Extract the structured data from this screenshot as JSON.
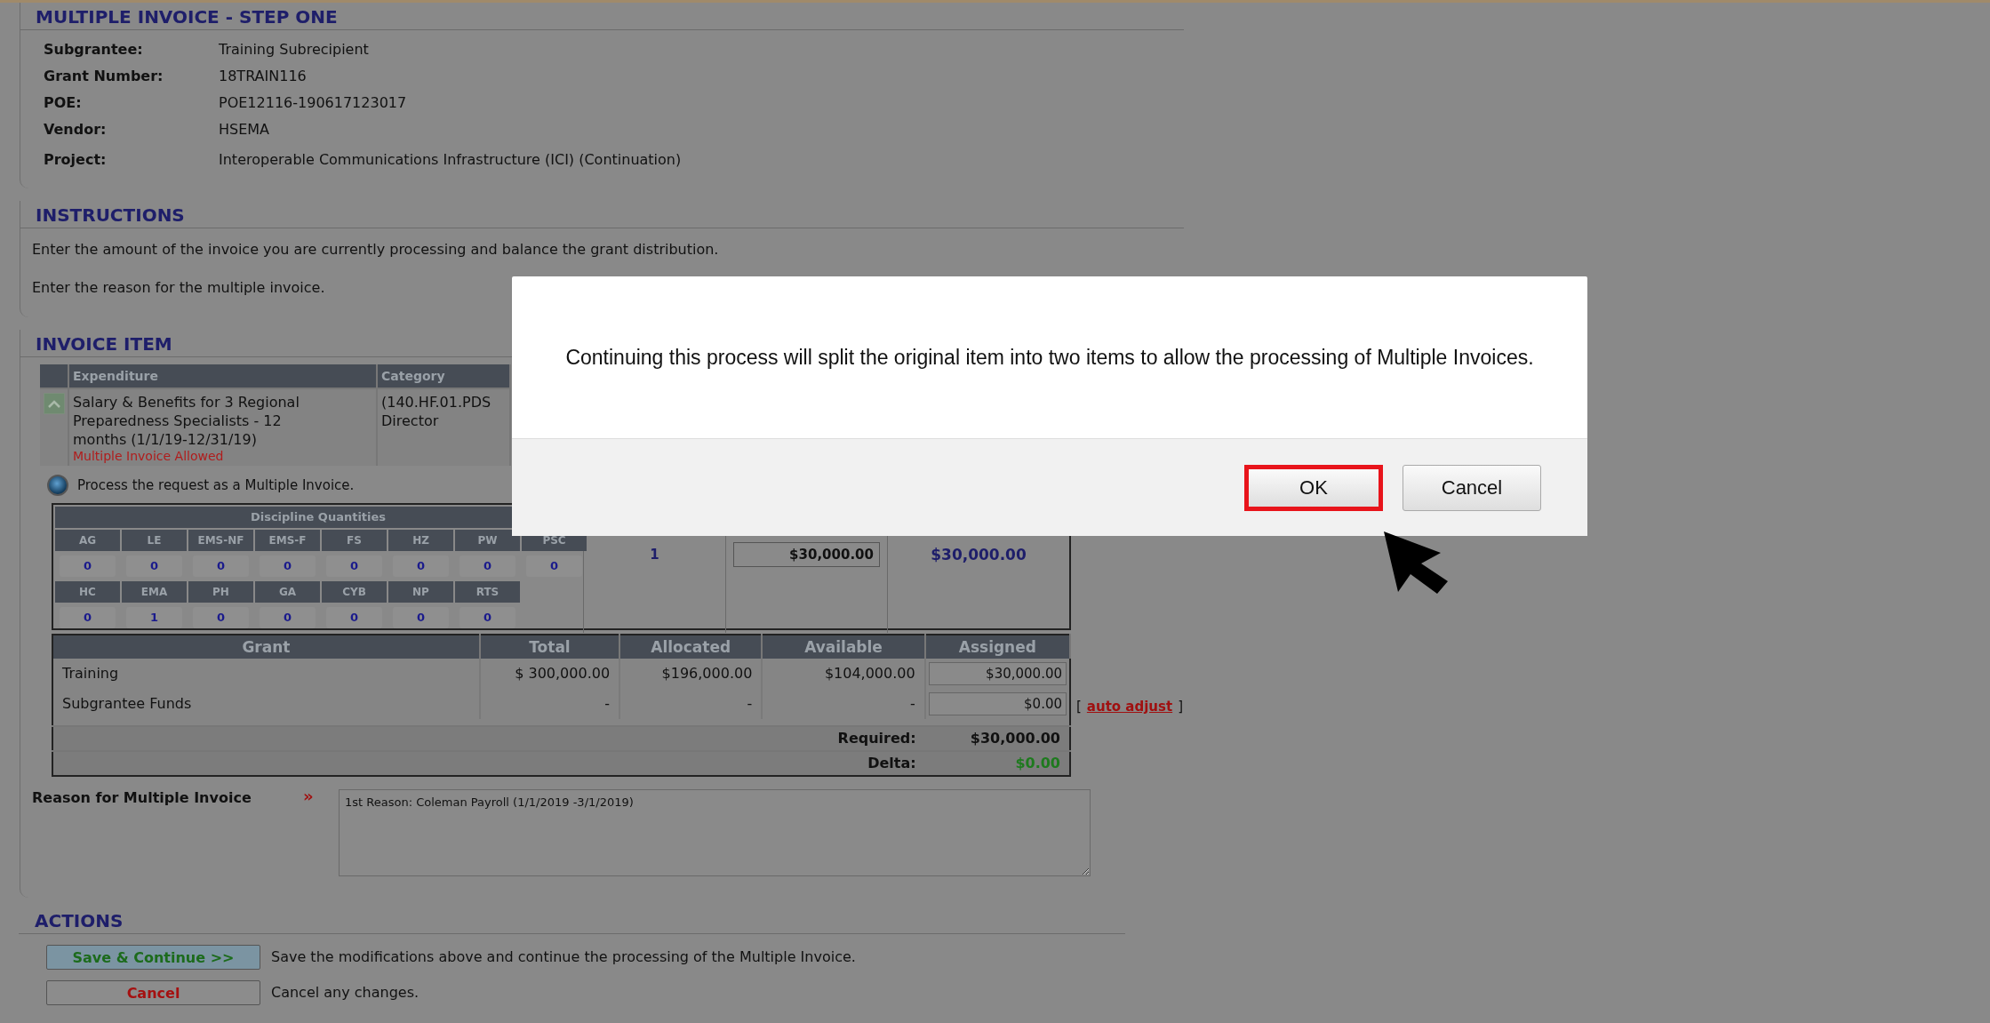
{
  "header": {
    "title": "MULTIPLE INVOICE - STEP ONE",
    "fields": [
      {
        "label": "Subgrantee:",
        "value": "Training Subrecipient"
      },
      {
        "label": "Grant Number:",
        "value": "18TRAIN116"
      },
      {
        "label": "POE:",
        "value": "POE12116-190617123017"
      },
      {
        "label": "Vendor:",
        "value": "HSEMA"
      },
      {
        "label": "Project:",
        "value": "Interoperable Communications Infrastructure (ICI) (Continuation)"
      }
    ]
  },
  "instructions": {
    "title": "INSTRUCTIONS",
    "lines": [
      "Enter the amount of the invoice you are currently processing and balance the grant distribution.",
      "Enter the reason for the multiple invoice."
    ]
  },
  "invoice_item": {
    "title": "INVOICE ITEM",
    "columns": [
      "Expenditure",
      "Category"
    ],
    "row": {
      "expanded": true,
      "expenditure": "Salary & Benefits for 3 Regional Preparedness Specialists - 12 months (1/1/19-12/31/19)",
      "note": "Multiple Invoice Allowed",
      "category": [
        "(140.HF.01.PDS",
        "Director"
      ]
    },
    "option": {
      "label": "Process the request as a Multiple Invoice.",
      "selected": true
    },
    "discipline": {
      "title": "Discipline Quantities",
      "rows": [
        [
          {
            "code": "AG",
            "qty": "0"
          },
          {
            "code": "LE",
            "qty": "0"
          },
          {
            "code": "EMS-NF",
            "qty": "0"
          },
          {
            "code": "EMS-F",
            "qty": "0"
          },
          {
            "code": "FS",
            "qty": "0"
          },
          {
            "code": "HZ",
            "qty": "0"
          },
          {
            "code": "PW",
            "qty": "0"
          },
          {
            "code": "PSC",
            "qty": "0"
          }
        ],
        [
          {
            "code": "HC",
            "qty": "0"
          },
          {
            "code": "EMA",
            "qty": "1"
          },
          {
            "code": "PH",
            "qty": "0"
          },
          {
            "code": "GA",
            "qty": "0"
          },
          {
            "code": "CYB",
            "qty": "0"
          },
          {
            "code": "NP",
            "qty": "0"
          },
          {
            "code": "RTS",
            "qty": "0"
          }
        ]
      ]
    },
    "quantity": "1",
    "unit_cost": "$30,000.00",
    "line_total": "$30,000.00",
    "grant_table": {
      "columns": [
        "Grant",
        "Total",
        "Allocated",
        "Available",
        "Assigned"
      ],
      "rows": [
        {
          "grant": "Training",
          "total": "$ 300,000.00",
          "allocated": "$196,000.00",
          "available": "$104,000.00",
          "assigned": "$30,000.00"
        },
        {
          "grant": "Subgrantee Funds",
          "total": "-",
          "allocated": "-",
          "available": "-",
          "assigned": "$0.00",
          "link": {
            "open": "[",
            "label": "auto adjust",
            "close": "]"
          }
        }
      ],
      "summary": [
        {
          "kind": "required",
          "label": "Required:",
          "value": "$30,000.00"
        },
        {
          "kind": "delta",
          "label": "Delta:",
          "value": "$0.00"
        }
      ]
    },
    "reason": {
      "label": "Reason for Multiple Invoice",
      "marker": "»",
      "value": "1st Reason: Coleman Payroll (1/1/2019 -3/1/2019)"
    }
  },
  "actions": {
    "title": "ACTIONS",
    "items": [
      {
        "kind": "primary",
        "button": "Save & Continue >>",
        "description": "Save the modifications above and continue the processing of the Multiple Invoice."
      },
      {
        "kind": "cancel",
        "button": "Cancel",
        "description": "Cancel any changes."
      }
    ]
  },
  "dialog": {
    "message": "Continuing this process will split the original item into two items to allow the processing of Multiple Invoices.",
    "buttons": [
      {
        "label": "OK",
        "highlighted": true
      },
      {
        "label": "Cancel",
        "highlighted": false
      }
    ]
  }
}
